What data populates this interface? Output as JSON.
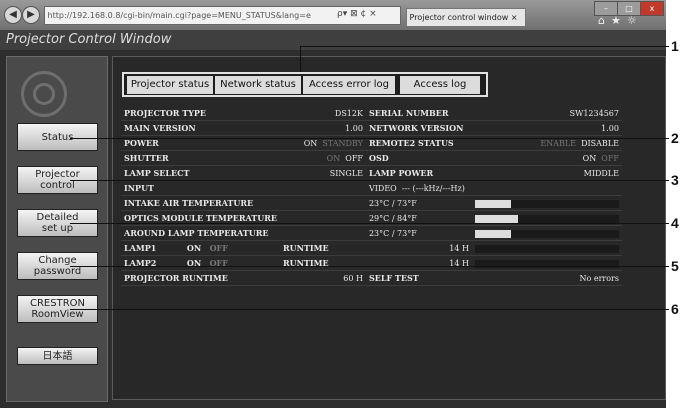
{
  "browser": {
    "address": "http://192.168.0.8/cgi-bin/main.cgi?page=MENU_STATUS&lang=e",
    "address_host": "192.168.0.8",
    "tab_title": "Projector control window",
    "search_icons": "ρ▾ ⊠ ¢ ×",
    "window_controls": [
      "–",
      "□",
      "x"
    ],
    "toolbar_icons": [
      "⌂",
      "★",
      "☼"
    ]
  },
  "app": {
    "title": "Projector Control Window"
  },
  "sidebar": {
    "buttons": [
      {
        "label": "Status"
      },
      {
        "label": "Projector\ncontrol"
      },
      {
        "label": "Detailed\nset up"
      },
      {
        "label": "Change\npassword"
      },
      {
        "label": "CRESTRON\nRoomView"
      },
      {
        "label": "日本語"
      }
    ]
  },
  "tabs": [
    {
      "label": "Projector status"
    },
    {
      "label": "Network status"
    },
    {
      "label": "Access error log"
    },
    {
      "label": "Access log"
    }
  ],
  "status": {
    "projector_type": {
      "label": "PROJECTOR TYPE",
      "value": "DS12K"
    },
    "serial_number": {
      "label": "SERIAL NUMBER",
      "value": "SW1234567"
    },
    "main_version": {
      "label": "MAIN VERSION",
      "value": "1.00"
    },
    "network_version": {
      "label": "NETWORK VERSION",
      "value": "1.00"
    },
    "power": {
      "label": "POWER",
      "on": "ON",
      "standby": "STANDBY"
    },
    "remote2": {
      "label": "REMOTE2 STATUS",
      "enable": "ENABLE",
      "disable": "DISABLE"
    },
    "shutter": {
      "label": "SHUTTER",
      "on": "ON",
      "off": "OFF"
    },
    "osd": {
      "label": "OSD",
      "on": "ON",
      "off": "OFF"
    },
    "lamp_select": {
      "label": "LAMP SELECT",
      "value": "SINGLE"
    },
    "lamp_power": {
      "label": "LAMP POWER",
      "value": "MIDDLE"
    },
    "input": {
      "label": "INPUT",
      "value": "VIDEO",
      "signal": "--- (---kHz/---Hz)"
    },
    "intake_temp": {
      "label": "INTAKE AIR TEMPERATURE",
      "value": "23°C / 73°F",
      "level": 0.25
    },
    "optics_temp": {
      "label": "OPTICS MODULE TEMPERATURE",
      "value": "29°C / 84°F",
      "level": 0.3
    },
    "around_lamp_temp": {
      "label": "AROUND LAMP TEMPERATURE",
      "value": "23°C / 73°F",
      "level": 0.25
    },
    "lamp1": {
      "label": "LAMP1",
      "on": "ON",
      "off": "OFF",
      "runtime_label": "RUNTIME",
      "runtime": "14 H"
    },
    "lamp2": {
      "label": "LAMP2",
      "on": "ON",
      "off": "OFF",
      "runtime_label": "RUNTIME",
      "runtime": "14 H"
    },
    "projector_runtime": {
      "label": "PROJECTOR RUNTIME",
      "value": "60 H"
    },
    "self_test": {
      "label": "SELF TEST",
      "value": "No errors"
    }
  },
  "callouts": [
    "1",
    "2",
    "3",
    "4",
    "5",
    "6"
  ]
}
